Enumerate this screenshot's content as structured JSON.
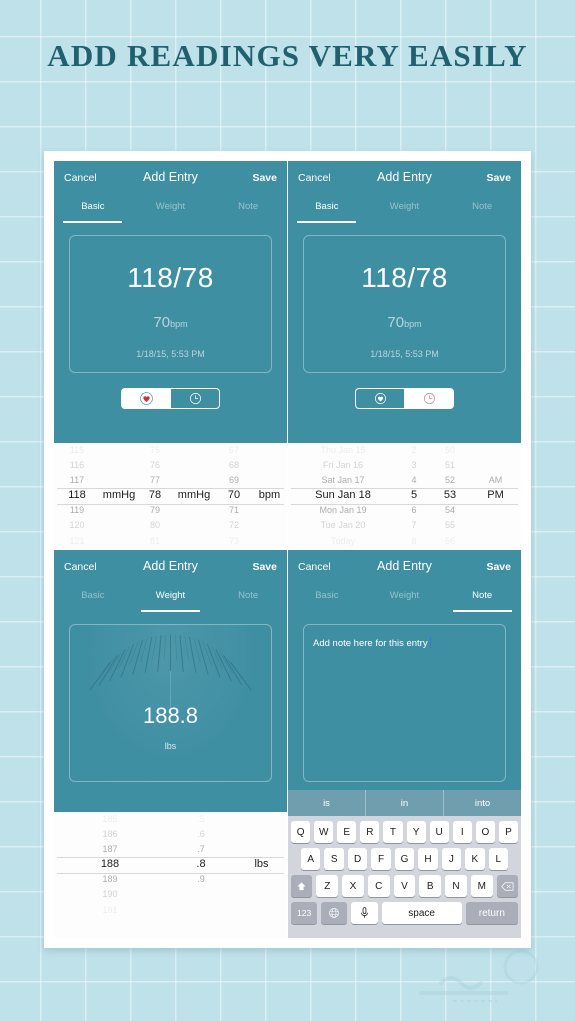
{
  "headline": "ADD READINGS VERY EASILY",
  "nav": {
    "cancel": "Cancel",
    "title": "Add Entry",
    "save": "Save",
    "tabs": [
      "Basic",
      "Weight",
      "Note"
    ]
  },
  "panel_basic_left": {
    "active_tab": "Basic",
    "bp_value": "118/78",
    "pulse": "70",
    "pulse_unit": "bpm",
    "timestamp": "1/18/15, 5:53 PM",
    "segment_selected": "heart",
    "picker": {
      "columns": [
        {
          "name": "systolic",
          "values": [
            "115",
            "116",
            "117",
            "118",
            "119",
            "120",
            "121"
          ],
          "selected_index": 3
        },
        {
          "name": "systolic-unit",
          "values": [
            "",
            "",
            "",
            "mmHg",
            "",
            "",
            ""
          ],
          "selected_index": 3
        },
        {
          "name": "diastolic",
          "values": [
            "75",
            "76",
            "77",
            "78",
            "79",
            "80",
            "81"
          ],
          "selected_index": 3
        },
        {
          "name": "diastolic-unit",
          "values": [
            "",
            "",
            "",
            "mmHg",
            "",
            "",
            ""
          ],
          "selected_index": 3
        },
        {
          "name": "pulse",
          "values": [
            "67",
            "68",
            "69",
            "70",
            "71",
            "72",
            "73"
          ],
          "selected_index": 3
        },
        {
          "name": "pulse-unit",
          "values": [
            "",
            "",
            "",
            "bpm",
            "",
            "",
            ""
          ],
          "selected_index": 3
        }
      ]
    }
  },
  "panel_basic_right": {
    "active_tab": "Basic",
    "bp_value": "118/78",
    "pulse": "70",
    "pulse_unit": "bpm",
    "timestamp": "1/18/15, 5:53 PM",
    "segment_selected": "clock",
    "picker": {
      "columns": [
        {
          "name": "date",
          "values": [
            "Thu Jan 15",
            "Fri Jan 16",
            "Sat Jan 17",
            "Sun Jan 18",
            "Mon Jan 19",
            "Tue Jan 20",
            "Today"
          ],
          "selected_index": 3
        },
        {
          "name": "hour",
          "values": [
            "2",
            "3",
            "4",
            "5",
            "6",
            "7",
            "8"
          ],
          "selected_index": 3
        },
        {
          "name": "minute",
          "values": [
            "50",
            "51",
            "52",
            "53",
            "54",
            "55",
            "56"
          ],
          "selected_index": 3
        },
        {
          "name": "meridiem",
          "values": [
            "",
            "",
            "AM",
            "PM",
            "",
            "",
            ""
          ],
          "selected_index": 3
        }
      ]
    }
  },
  "panel_weight": {
    "active_tab": "Weight",
    "dial_value": "188.8",
    "dial_unit": "lbs",
    "picker": {
      "columns": [
        {
          "name": "weight-whole",
          "values": [
            "185",
            "186",
            "187",
            "188",
            "189",
            "190",
            "191"
          ],
          "selected_index": 3
        },
        {
          "name": "weight-decimal",
          "values": [
            ".5",
            ".6",
            ".7",
            ".8",
            ".9",
            "",
            ""
          ],
          "selected_index": 3
        },
        {
          "name": "weight-unit",
          "values": [
            "",
            "",
            "",
            "lbs",
            "",
            "",
            ""
          ],
          "selected_index": 3
        }
      ]
    }
  },
  "panel_note": {
    "active_tab": "Note",
    "note_text": "Add note here for this entry",
    "keyboard": {
      "suggestions": [
        "is",
        "in",
        "into"
      ],
      "row1": [
        "Q",
        "W",
        "E",
        "R",
        "T",
        "Y",
        "U",
        "I",
        "O",
        "P"
      ],
      "row2": [
        "A",
        "S",
        "D",
        "F",
        "G",
        "H",
        "J",
        "K",
        "L"
      ],
      "row3": [
        "Z",
        "X",
        "C",
        "V",
        "B",
        "N",
        "M"
      ],
      "shift_key": "shift-icon",
      "backspace_key": "backspace-icon",
      "numbers_key": "123",
      "globe_key": "globe-icon",
      "mic_key": "mic-icon",
      "space_key": "space",
      "return_key": "return"
    }
  },
  "colors": {
    "background": "#bfe2ea",
    "headline": "#21606e",
    "teal_panel": "#3f8fa3",
    "keyboard_bg": "#d2d6dc",
    "suggest_bg": "#6f9fae",
    "caret": "#2f7ad6",
    "heart_red": "#c8333e"
  }
}
